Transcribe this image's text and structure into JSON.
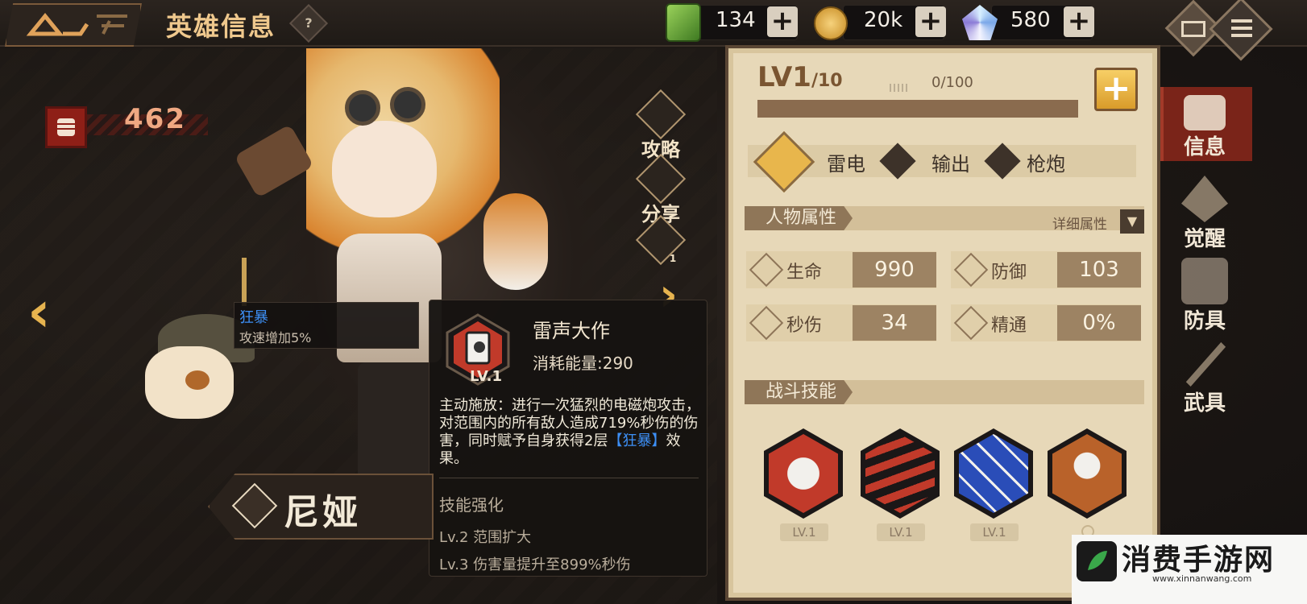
{
  "header": {
    "title": "英雄信息",
    "help_icon": "question-icon",
    "resources": [
      {
        "icon": "green-crystal-icon",
        "value": "134"
      },
      {
        "icon": "gold-coin-icon",
        "value": "20k"
      },
      {
        "icon": "blue-diamond-icon",
        "value": "580"
      }
    ]
  },
  "hero": {
    "power": "462",
    "name": "尼娅",
    "side_buttons": [
      "攻略",
      "分享"
    ],
    "favor_count": "1"
  },
  "buff_tooltip": {
    "name": "狂暴",
    "desc": "攻速增加5%"
  },
  "skill_tooltip": {
    "name": "雷声大作",
    "level": "LV.1",
    "cost": "消耗能量:290",
    "desc_before": "主动施放：进行一次猛烈的电磁炮攻击，对范围内的所有敌人造成719%秒伤的伤害，同时赋予自身获得2层",
    "desc_highlight": "【狂暴】",
    "desc_after": "效果。",
    "enhance_title": "技能强化",
    "enhance_lines": [
      "Lv.2  范围扩大",
      "Lv.3  伤害量提升至899%秒伤"
    ]
  },
  "info": {
    "level": "LV1",
    "level_max": "/10",
    "exp_text": "0/100",
    "exp_fraction": 0,
    "tags": [
      "雷电",
      "输出",
      "枪炮"
    ],
    "attr_title": "人物属性",
    "detail_label": "详细属性",
    "stats": [
      {
        "label": "生命",
        "value": "990"
      },
      {
        "label": "防御",
        "value": "103"
      },
      {
        "label": "秒伤",
        "value": "34"
      },
      {
        "label": "精通",
        "value": "0%"
      }
    ],
    "skills_title": "战斗技能",
    "skill_levels": [
      "LV.1",
      "LV.1",
      "LV.1"
    ]
  },
  "tabs": [
    "信息",
    "觉醒",
    "防具",
    "武具"
  ],
  "watermark": {
    "text": "消费手游网",
    "url": "www.xinnanwang.com"
  },
  "colors": {
    "accent_gold": "#e8b64c",
    "panel_bg": "#e7d8b8",
    "highlight_blue": "#3d8ff5",
    "power_red": "#8e1f17"
  }
}
